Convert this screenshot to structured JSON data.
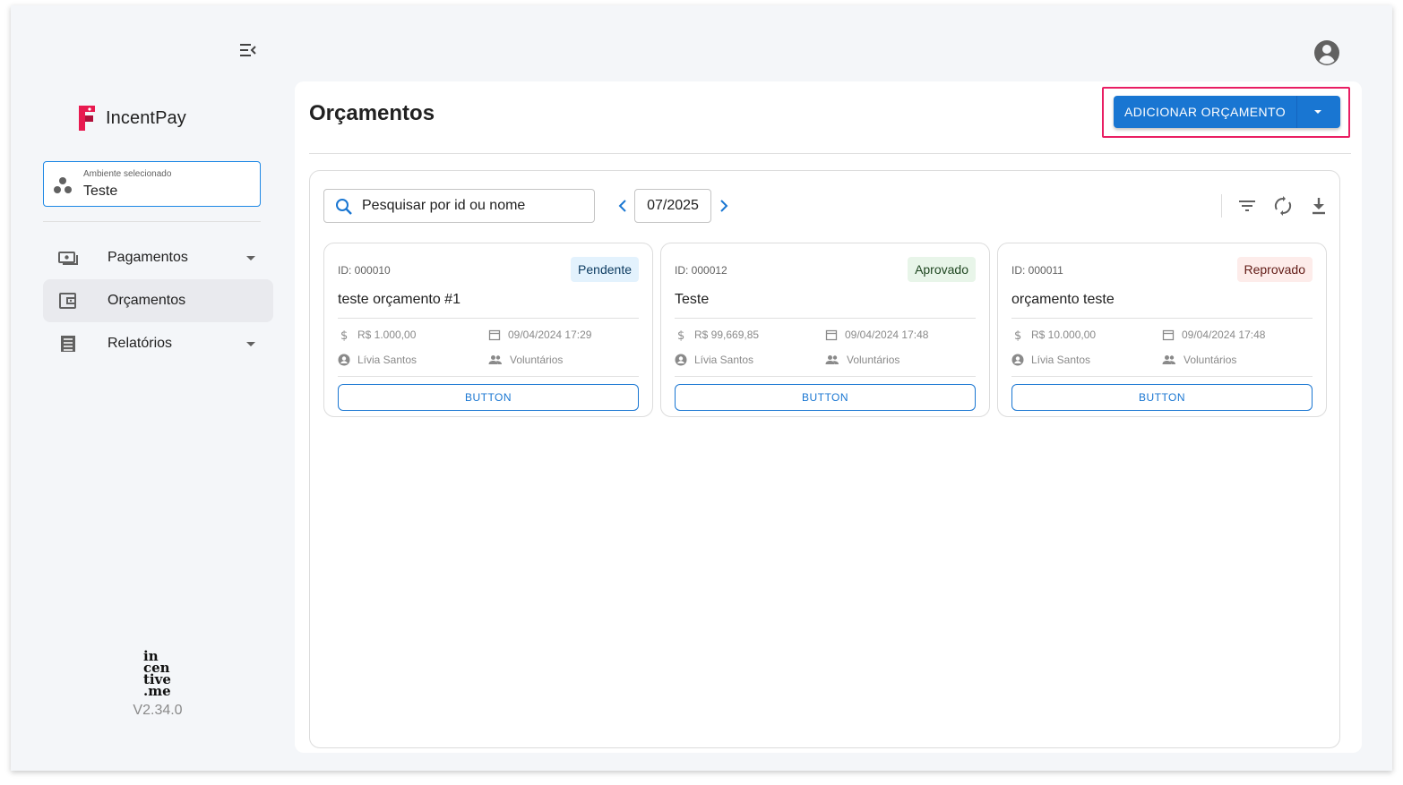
{
  "sidebar": {
    "brand_name": "IncentPay",
    "environment": {
      "label": "Ambiente selecionado",
      "value": "Teste"
    },
    "items": [
      {
        "label": "Pagamentos",
        "icon": "payments-icon",
        "has_dropdown": true,
        "active": false
      },
      {
        "label": "Orçamentos",
        "icon": "wallet-icon",
        "has_dropdown": false,
        "active": true
      },
      {
        "label": "Relatórios",
        "icon": "report-icon",
        "has_dropdown": true,
        "active": false
      }
    ],
    "footer_logo": "incentive.me",
    "version": "V2.34.0"
  },
  "header": {
    "title": "Orçamentos",
    "add_button_label": "ADICIONAR ORÇAMENTO"
  },
  "toolbar": {
    "search_placeholder": "Pesquisar por id ou nome",
    "period": "07/2025"
  },
  "cards": [
    {
      "id": "ID: 000010",
      "status": "Pendente",
      "status_bg": "#e3f2fd",
      "status_color": "#0d3c61",
      "title": "teste orçamento #1",
      "amount": "R$ 1.000,00",
      "date": "09/04/2024 17:29",
      "owner": "Lívia Santos",
      "group": "Voluntários",
      "button": "BUTTON"
    },
    {
      "id": "ID: 000012",
      "status": "Aprovado",
      "status_bg": "#e8f5e9",
      "status_color": "#1e4620",
      "title": "Teste",
      "amount": "R$ 99,669,85",
      "date": "09/04/2024 17:48",
      "owner": "Lívia Santos",
      "group": "Voluntários",
      "button": "BUTTON"
    },
    {
      "id": "ID: 000011",
      "status": "Reprovado",
      "status_bg": "#fdecea",
      "status_color": "#611a15",
      "title": "orçamento teste",
      "amount": "R$ 10.000,00",
      "date": "09/04/2024 17:48",
      "owner": "Lívia Santos",
      "group": "Voluntários",
      "button": "BUTTON"
    }
  ],
  "colors": {
    "primary": "#1976d2",
    "highlight": "#e91e63",
    "brand": "#e8194f"
  }
}
